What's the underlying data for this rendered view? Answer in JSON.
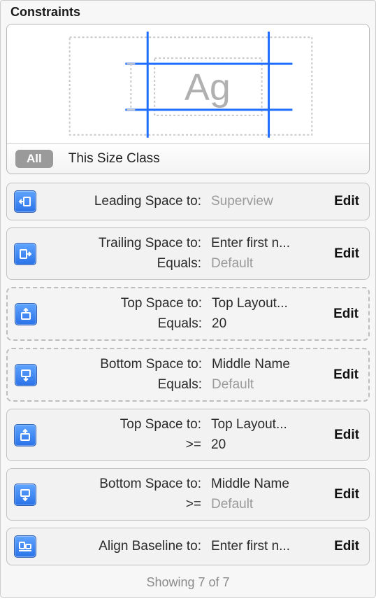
{
  "title": "Constraints",
  "diagram_label": "Ag",
  "tabs": {
    "all": "All",
    "size_class": "This Size Class"
  },
  "edit_label": "Edit",
  "rows": [
    {
      "icon": "leading",
      "dashed": false,
      "label1": "Leading Space to:",
      "val1": "Superview",
      "val1muted": true,
      "label2": "",
      "val2": ""
    },
    {
      "icon": "trailing",
      "dashed": false,
      "label1": "Trailing Space to:",
      "val1": "Enter first n...",
      "val1muted": false,
      "label2": "Equals:",
      "val2": "Default",
      "val2muted": true
    },
    {
      "icon": "top",
      "dashed": true,
      "label1": "Top Space to:",
      "val1": "Top Layout...",
      "val1muted": false,
      "label2": "Equals:",
      "val2": "20"
    },
    {
      "icon": "bottom",
      "dashed": true,
      "label1": "Bottom Space to:",
      "val1": "Middle Name",
      "val1muted": false,
      "label2": "Equals:",
      "val2": "Default",
      "val2muted": true
    },
    {
      "icon": "top",
      "dashed": false,
      "label1": "Top Space to:",
      "val1": "Top Layout...",
      "val1muted": false,
      "label2": ">=",
      "val2": "20"
    },
    {
      "icon": "bottom",
      "dashed": false,
      "label1": "Bottom Space to:",
      "val1": "Middle Name",
      "val1muted": false,
      "label2": ">=",
      "val2": "Default",
      "val2muted": true
    },
    {
      "icon": "baseline",
      "dashed": false,
      "label1": "Align Baseline to:",
      "val1": "Enter first n...",
      "val1muted": false,
      "label2": "",
      "val2": ""
    }
  ],
  "footer": "Showing 7 of 7"
}
